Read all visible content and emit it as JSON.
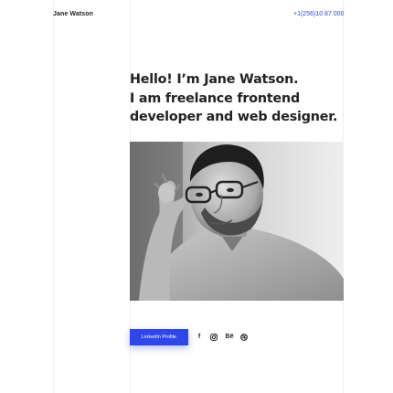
{
  "header": {
    "brand": "Jane Watson",
    "phone": "+1(256)10 87 000"
  },
  "hero": {
    "lines": [
      "Hello! I’m Jane Watson.",
      "I am freelance frontend",
      "developer and web designer."
    ]
  },
  "cta": {
    "linkedin_label": "LinkedIn Profile"
  },
  "social": [
    {
      "icon": "facebook-icon",
      "label": "f"
    },
    {
      "icon": "instagram-icon",
      "label": ""
    },
    {
      "icon": "behance-icon",
      "label": "Bē"
    },
    {
      "icon": "dribbble-icon",
      "label": ""
    }
  ],
  "colors": {
    "accent": "#2f47e8",
    "text": "#222222",
    "gridline": "#eeeeee"
  }
}
